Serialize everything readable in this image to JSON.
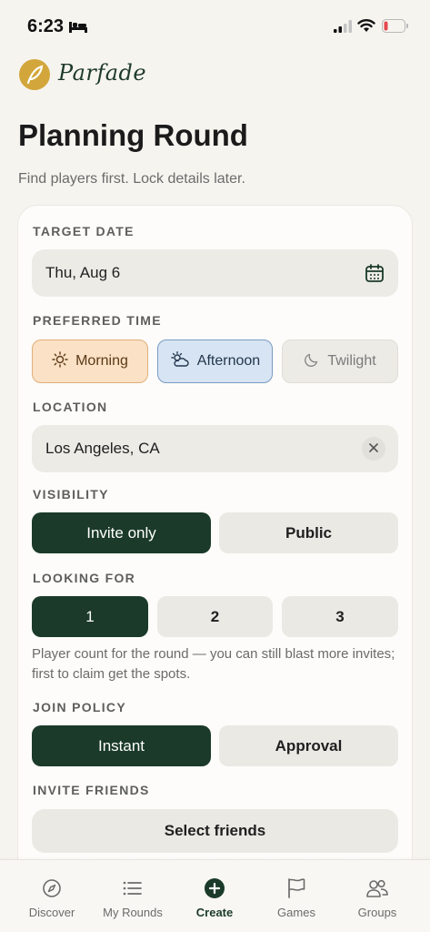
{
  "status_bar": {
    "time": "6:23"
  },
  "brand": {
    "name": "Parfade"
  },
  "page": {
    "title": "Planning Round",
    "subtitle": "Find players first. Lock details later."
  },
  "target_date": {
    "label": "TARGET DATE",
    "value": "Thu, Aug 6"
  },
  "preferred_time": {
    "label": "PREFERRED TIME",
    "options": [
      {
        "label": "Morning",
        "state": "selected"
      },
      {
        "label": "Afternoon",
        "state": "selected"
      },
      {
        "label": "Twilight",
        "state": "unselected"
      }
    ]
  },
  "location": {
    "label": "LOCATION",
    "value": "Los Angeles, CA"
  },
  "visibility": {
    "label": "VISIBILITY",
    "options": [
      "Invite only",
      "Public"
    ],
    "selected": "Invite only"
  },
  "looking_for": {
    "label": "LOOKING FOR",
    "options": [
      "1",
      "2",
      "3"
    ],
    "selected": "1",
    "helper": "Player count for the round — you can still blast more invites; first to claim get the spots."
  },
  "join_policy": {
    "label": "JOIN POLICY",
    "options": [
      "Instant",
      "Approval"
    ],
    "selected": "Instant"
  },
  "invite_friends": {
    "label": "INVITE FRIENDS",
    "button": "Select friends"
  },
  "tabs": [
    {
      "label": "Discover",
      "icon": "compass-icon"
    },
    {
      "label": "My Rounds",
      "icon": "list-icon"
    },
    {
      "label": "Create",
      "icon": "plus-circle-icon",
      "active": true
    },
    {
      "label": "Games",
      "icon": "flag-icon"
    },
    {
      "label": "Groups",
      "icon": "people-icon"
    }
  ],
  "colors": {
    "accent": "#1b3a29",
    "morning_bg": "#fbe1c5",
    "afternoon_bg": "#d7e4f3",
    "background": "#f6f4ef"
  }
}
